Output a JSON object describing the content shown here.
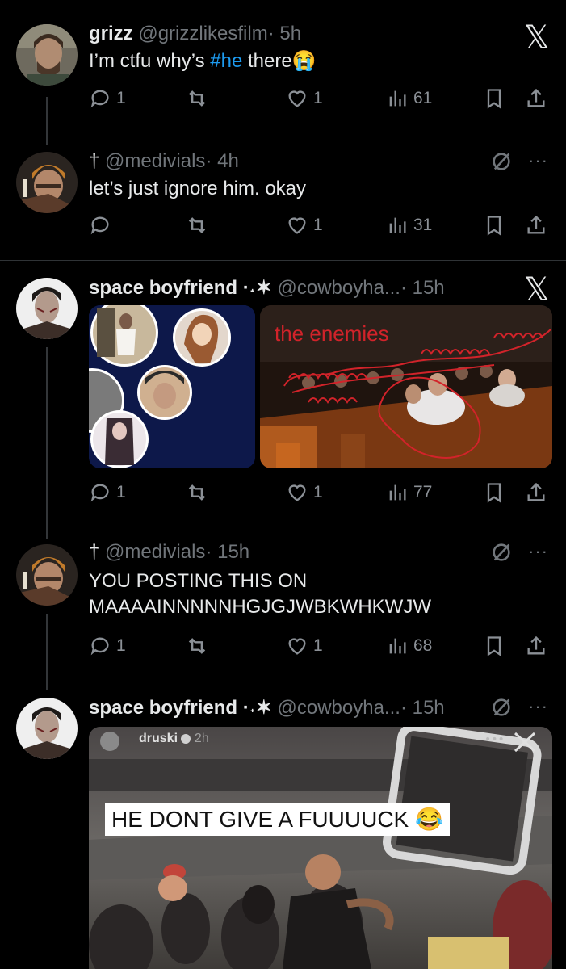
{
  "tweets": [
    {
      "name": "grizz",
      "handle": "@grizzlikesfilm",
      "time": "· 5h",
      "text_before": "I’m ctfu why’s ",
      "hashtag": "#he",
      "text_after": " there",
      "emoji": "😭",
      "replies": "1",
      "likes": "1",
      "views": "61"
    },
    {
      "name": "†",
      "handle": "@medivials",
      "time": "· 4h",
      "text": "let’s just ignore him. okay",
      "replies": "",
      "likes": "1",
      "views": "31"
    },
    {
      "name": "space boyfriend ·˖✶",
      "handle": "@cowboyha...",
      "time": "· 15h",
      "media_caption": "the enemies",
      "replies": "1",
      "likes": "1",
      "views": "77"
    },
    {
      "name": "†",
      "handle": "@medivials",
      "time": "· 15h",
      "text_line1": "YOU POSTING THIS ON",
      "text_line2": "MAAAAINNNNNHGJGJWBKWHKWJW",
      "replies": "1",
      "likes": "1",
      "views": "68"
    },
    {
      "name": "space boyfriend ·˖✶",
      "handle": "@cowboyha...",
      "time": "· 15h",
      "video_user": "druski",
      "video_time": "2h",
      "video_caption": "HE DONT GIVE A FUUUUCK",
      "video_emoji": "😂"
    }
  ],
  "icons": {
    "x_logo": "𝕏",
    "more": "···"
  },
  "colors": {
    "background": "#000000",
    "text": "#e7e9ea",
    "muted": "#71767b",
    "link": "#1d9bf0",
    "red_scribble": "#d2232a"
  }
}
